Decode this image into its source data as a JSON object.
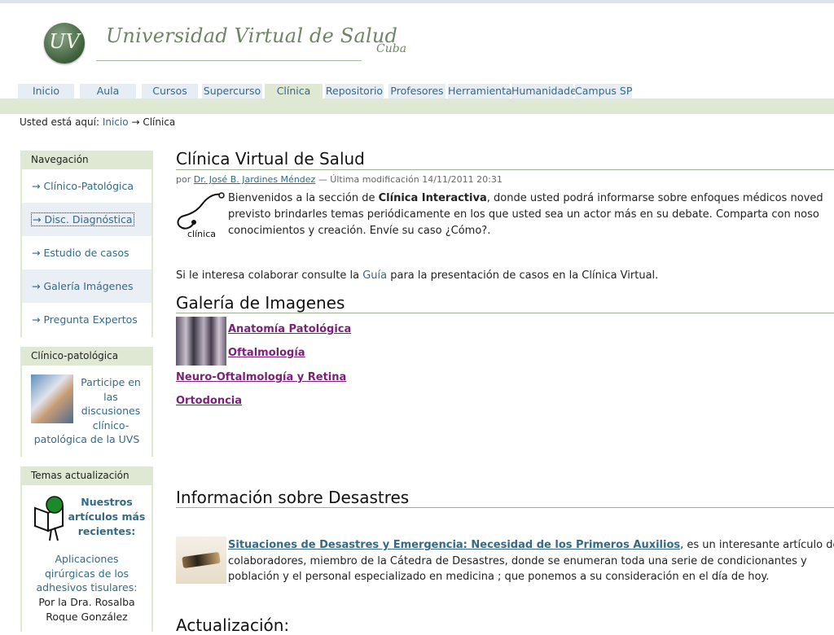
{
  "header": {
    "logo_monogram": "UV",
    "site_title": "Universidad Virtual de Salud",
    "site_subtitle": "Cuba"
  },
  "tabs": [
    {
      "label": "Inicio"
    },
    {
      "label": "Aula"
    },
    {
      "label": "Cursos"
    },
    {
      "label": "Supercurso"
    },
    {
      "label": "Clínica",
      "active": true
    },
    {
      "label": "Repositorio"
    },
    {
      "label": "Profesores"
    },
    {
      "label": "Herramienta"
    },
    {
      "label": "Humanidade"
    },
    {
      "label": "Campus SP"
    }
  ],
  "breadcrumb": {
    "prefix": "Usted está aquí:",
    "home": "Inicio",
    "arrow": "→",
    "current": "Clínica"
  },
  "sidebar": {
    "nav_title": "Navegación",
    "nav_items": [
      {
        "label": "→ Clínico-Patológica"
      },
      {
        "label": "→ Disc. Diagnóstica"
      },
      {
        "label": "→ Estudio de casos"
      },
      {
        "label": "→ Galería Imágenes"
      },
      {
        "label": "→ Pregunta Expertos"
      }
    ],
    "cp_title": "Clínico-patológica",
    "cp_text_lines": [
      "Participe en",
      "las",
      "discusiones",
      "clínico-",
      "patológica de la UVS"
    ],
    "temas_title": "Temas actualización",
    "temas_head_lines": [
      "Nuestros",
      "artículos más",
      "recientes:"
    ],
    "temas_article_lines": [
      "Aplicaciones",
      "qirúrgicas de los",
      "adhesivos tisulares:"
    ],
    "temas_author_lines": [
      "Por  la Dra. Rosalba",
      "Roque González"
    ]
  },
  "main": {
    "title": "Clínica Virtual de Salud",
    "byline_prefix": "por",
    "byline_author": "Dr. José B. Jardines Méndez",
    "byline_suffix": "— Última modificación 14/11/2011 20:31",
    "steth_label": "clínica",
    "intro_line1_a": "Bienvenidos a la sección de ",
    "intro_line1_b": "Clínica Interactiva",
    "intro_line1_c": ", donde usted podrá informarse sobre enfoques médicos noved",
    "intro_line2": "previsto brindarles temas periódicamente en los que usted sea un actor más en su debate. Comparta con noso",
    "intro_line3": "conocimientos y creación. Envíe su caso ¿Cómo?.",
    "para2_a": "Si le interesa colaborar consulte la ",
    "para2_link": "Guía",
    "para2_b": " para la presentación de casos en la Clínica Virtual.",
    "gallery_title": "Galería de Imagenes",
    "gallery_links": [
      "Anatomía Patológica",
      "Oftalmología",
      "Neuro-Oftalmología y Retina",
      "Ortodoncia"
    ],
    "disaster_title": "Información sobre Desastres",
    "disaster_link": "Situaciones de Desastres y Emergencia: Necesidad de los Primeros Auxilios",
    "disaster_line1_rest": ", es un interesante artículo de la",
    "disaster_line2": "colaboradores, miembro de la  Cátedra de Desastres, donde se enumeran toda una serie de condicionantes y",
    "disaster_line3": "población y el personal especializado en medicina ; que ponemos a su consideración en el día de hoy.",
    "actualizacion_title": "Actualización:"
  },
  "colors": {
    "accent_green": "#dfe8d3",
    "link_blue": "#346a86",
    "visited_purple": "#7b1f7a"
  }
}
